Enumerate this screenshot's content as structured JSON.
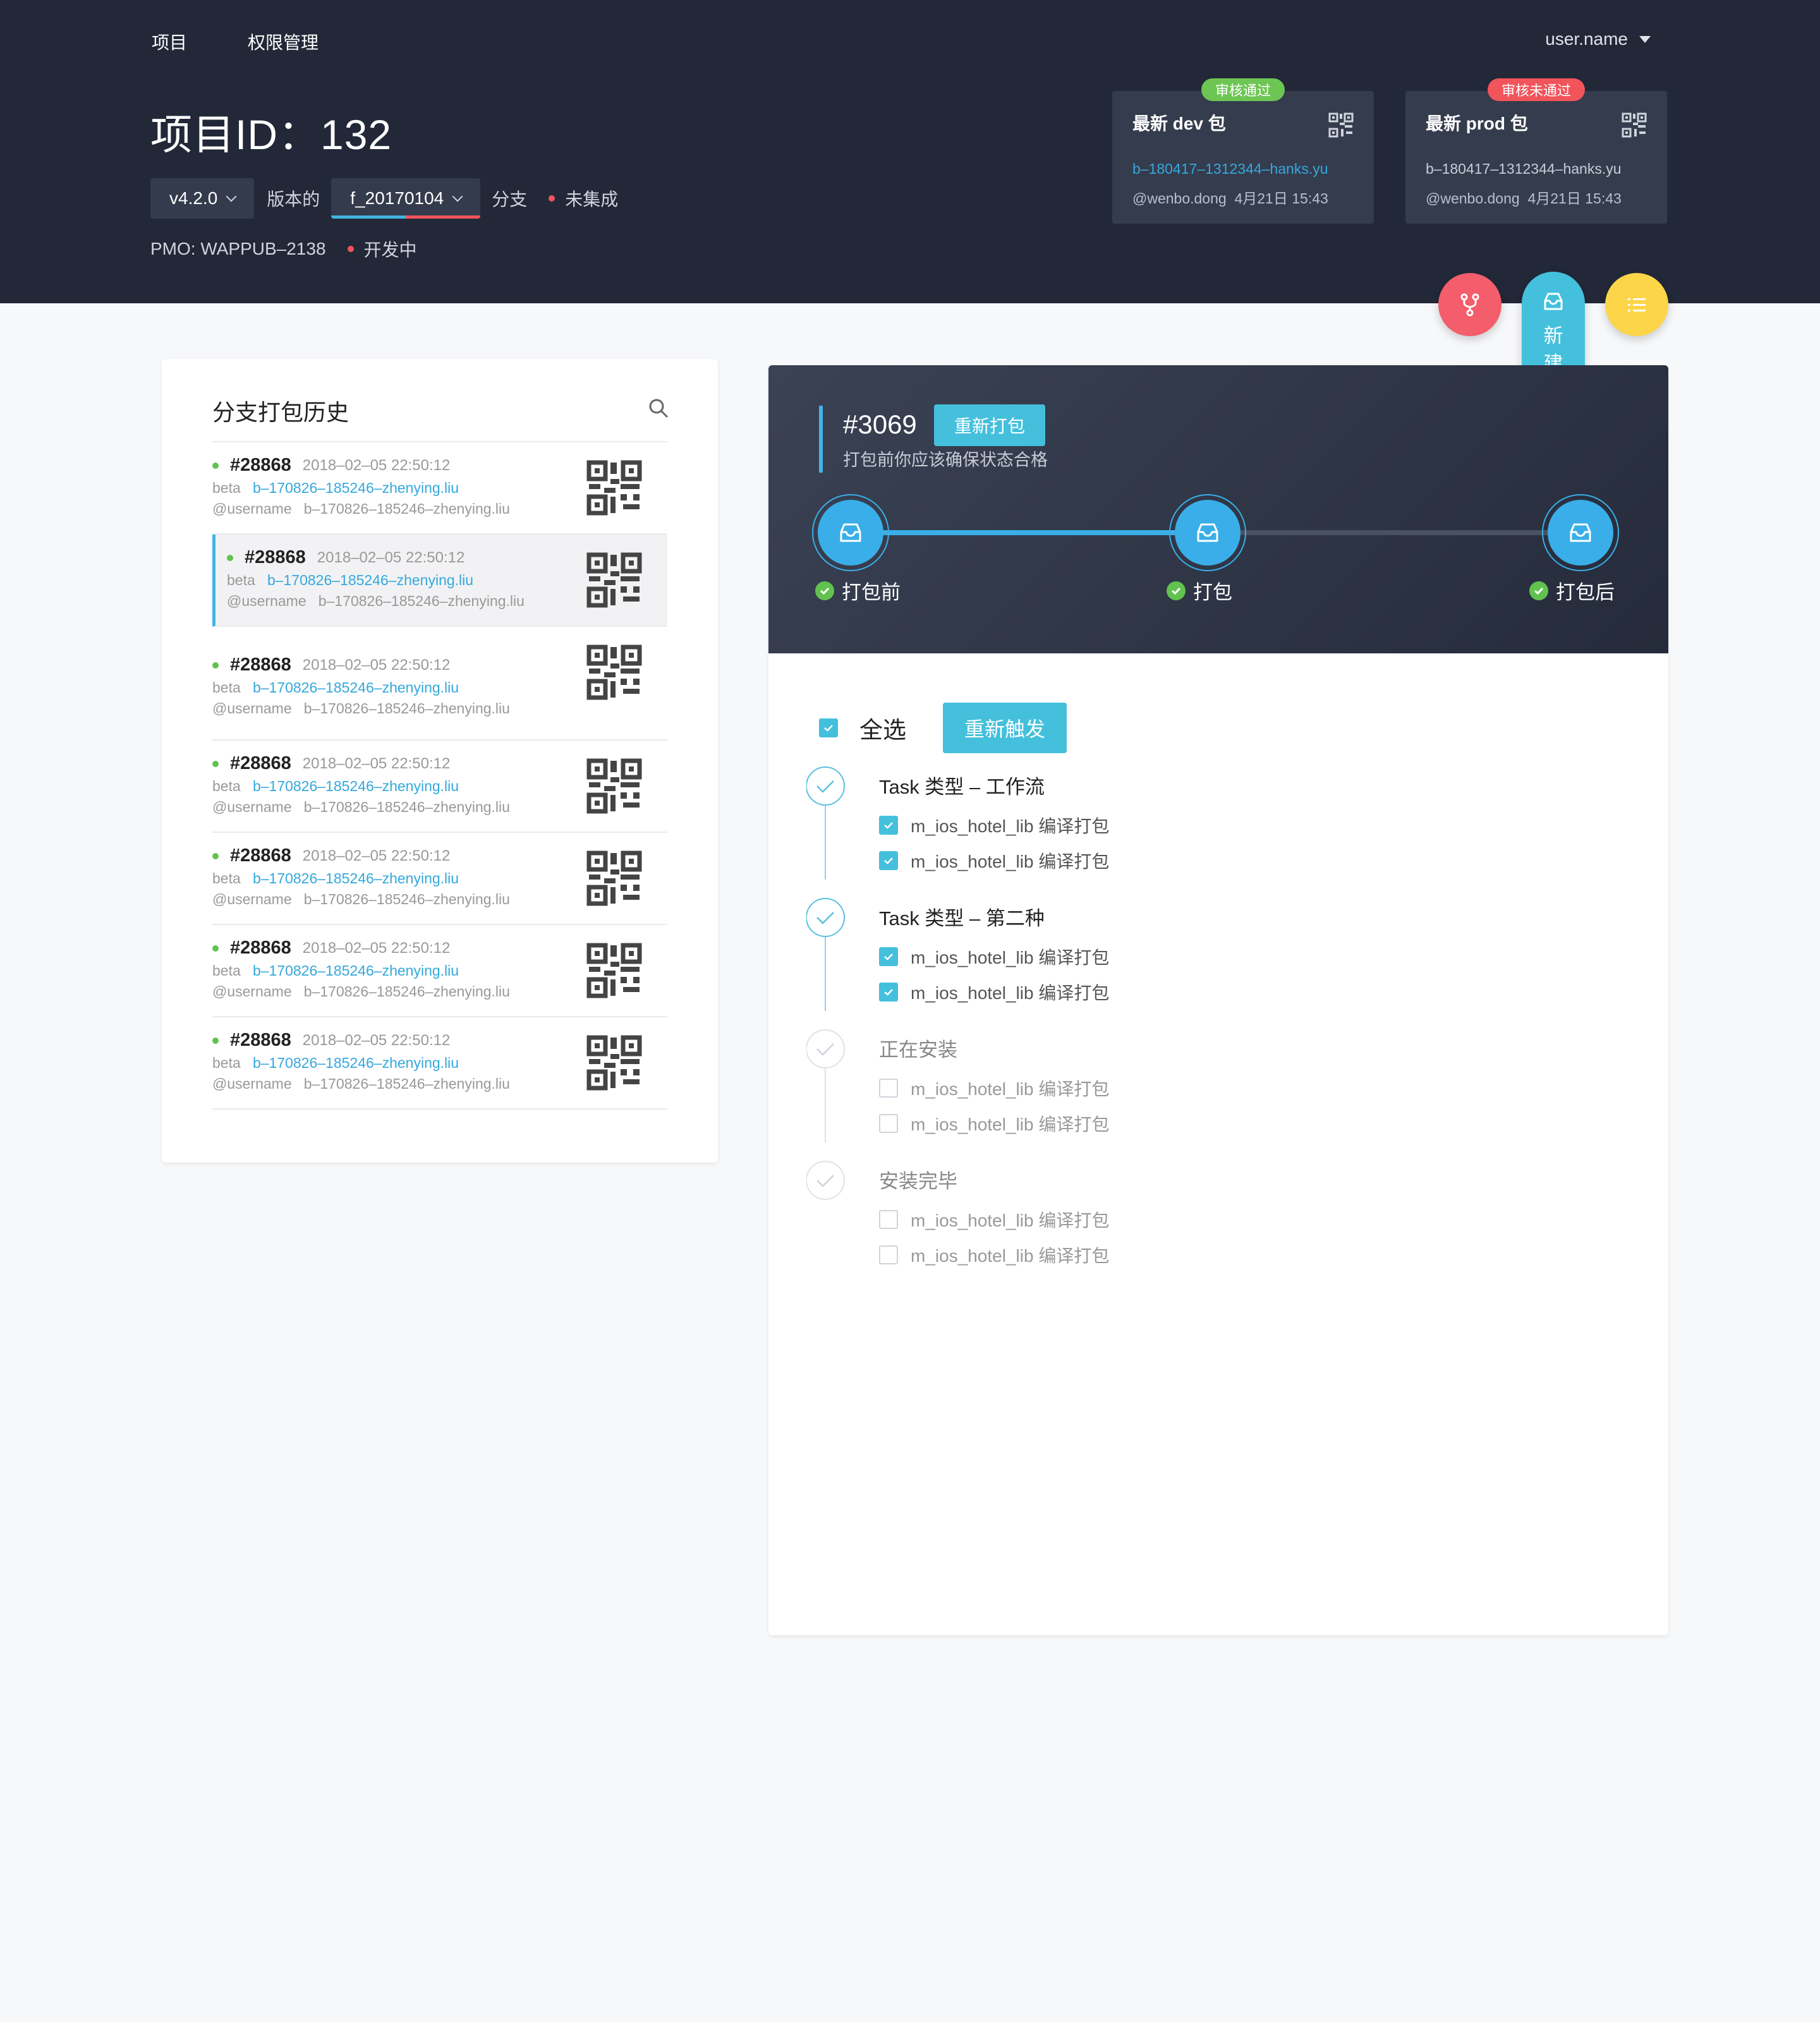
{
  "nav": {
    "items": [
      "项目",
      "权限管理"
    ],
    "user": "user.name"
  },
  "project": {
    "title": "项目ID：132",
    "version": "v4.2.0",
    "version_suffix": "版本的",
    "branch": "f_20170104",
    "branch_suffix": "分支",
    "integration_status": "未集成",
    "pmo": "PMO: WAPPUB–2138",
    "dev_status": "开发中"
  },
  "packages": [
    {
      "title": "最新 dev 包",
      "badge": "审核通过",
      "badge_color": "#6dc653",
      "link": "b–180417–1312344–hanks.yu",
      "link_color": "#35a8dc",
      "author": "@wenbo.dong",
      "time": "4月21日 15:43"
    },
    {
      "title": "最新 prod 包",
      "badge": "审核未通过",
      "badge_color": "#f2545b",
      "link": "b–180417–1312344–hanks.yu",
      "link_color": "#c7ccd6",
      "author": "@wenbo.dong",
      "time": "4月21日 15:43"
    }
  ],
  "fab": {
    "new_build_label": "新建打包",
    "colors": {
      "branch": "#f45d6b",
      "new": "#44c0dd",
      "list": "#fcd549"
    },
    "icons": [
      "branch-icon",
      "inbox-icon",
      "list-icon"
    ]
  },
  "history": {
    "title": "分支打包历史",
    "items": [
      {
        "num": "#28868",
        "time": "2018–02–05 22:50:12",
        "env": "beta",
        "link": "b–170826–185246–zhenying.liu",
        "user": "@username",
        "ref": "b–170826–185246–zhenying.liu"
      },
      {
        "num": "#28868",
        "time": "2018–02–05 22:50:12",
        "env": "beta",
        "link": "b–170826–185246–zhenying.liu",
        "user": "@username",
        "ref": "b–170826–185246–zhenying.liu"
      },
      {
        "num": "#28868",
        "time": "2018–02–05 22:50:12",
        "env": "beta",
        "link": "b–170826–185246–zhenying.liu",
        "user": "@username",
        "ref": "b–170826–185246–zhenying.liu"
      },
      {
        "num": "#28868",
        "time": "2018–02–05 22:50:12",
        "env": "beta",
        "link": "b–170826–185246–zhenying.liu",
        "user": "@username",
        "ref": "b–170826–185246–zhenying.liu"
      },
      {
        "num": "#28868",
        "time": "2018–02–05 22:50:12",
        "env": "beta",
        "link": "b–170826–185246–zhenying.liu",
        "user": "@username",
        "ref": "b–170826–185246–zhenying.liu"
      },
      {
        "num": "#28868",
        "time": "2018–02–05 22:50:12",
        "env": "beta",
        "link": "b–170826–185246–zhenying.liu",
        "user": "@username",
        "ref": "b–170826–185246–zhenying.liu"
      },
      {
        "num": "#28868",
        "time": "2018–02–05 22:50:12",
        "env": "beta",
        "link": "b–170826–185246–zhenying.liu",
        "user": "@username",
        "ref": "b–170826–185246–zhenying.liu"
      }
    ]
  },
  "build": {
    "id": "#3069",
    "rebuild_label": "重新打包",
    "subtitle": "打包前你应该确保状态合格",
    "steps": [
      "打包前",
      "打包",
      "打包后"
    ],
    "select_all": "全选",
    "retrigger_label": "重新触发",
    "tasks": [
      {
        "title": "Task 类型 – 工作流",
        "done": true,
        "subs": [
          {
            "label": "m_ios_hotel_lib 编译打包",
            "checked": true
          },
          {
            "label": "m_ios_hotel_lib 编译打包",
            "checked": true
          }
        ]
      },
      {
        "title": "Task 类型 – 第二种",
        "done": true,
        "subs": [
          {
            "label": "m_ios_hotel_lib 编译打包",
            "checked": true
          },
          {
            "label": "m_ios_hotel_lib 编译打包",
            "checked": true
          }
        ]
      },
      {
        "title": "正在安装",
        "done": false,
        "subs": [
          {
            "label": "m_ios_hotel_lib 编译打包",
            "checked": false
          },
          {
            "label": "m_ios_hotel_lib 编译打包",
            "checked": false
          }
        ]
      },
      {
        "title": "安装完毕",
        "done": false,
        "subs": [
          {
            "label": "m_ios_hotel_lib 编译打包",
            "checked": false
          },
          {
            "label": "m_ios_hotel_lib 编译打包",
            "checked": false
          }
        ]
      }
    ]
  },
  "colors": {
    "accent": "#44c0dd",
    "header_bg": "#222838",
    "status_red": "#f2545b",
    "status_green": "#62c24f"
  }
}
